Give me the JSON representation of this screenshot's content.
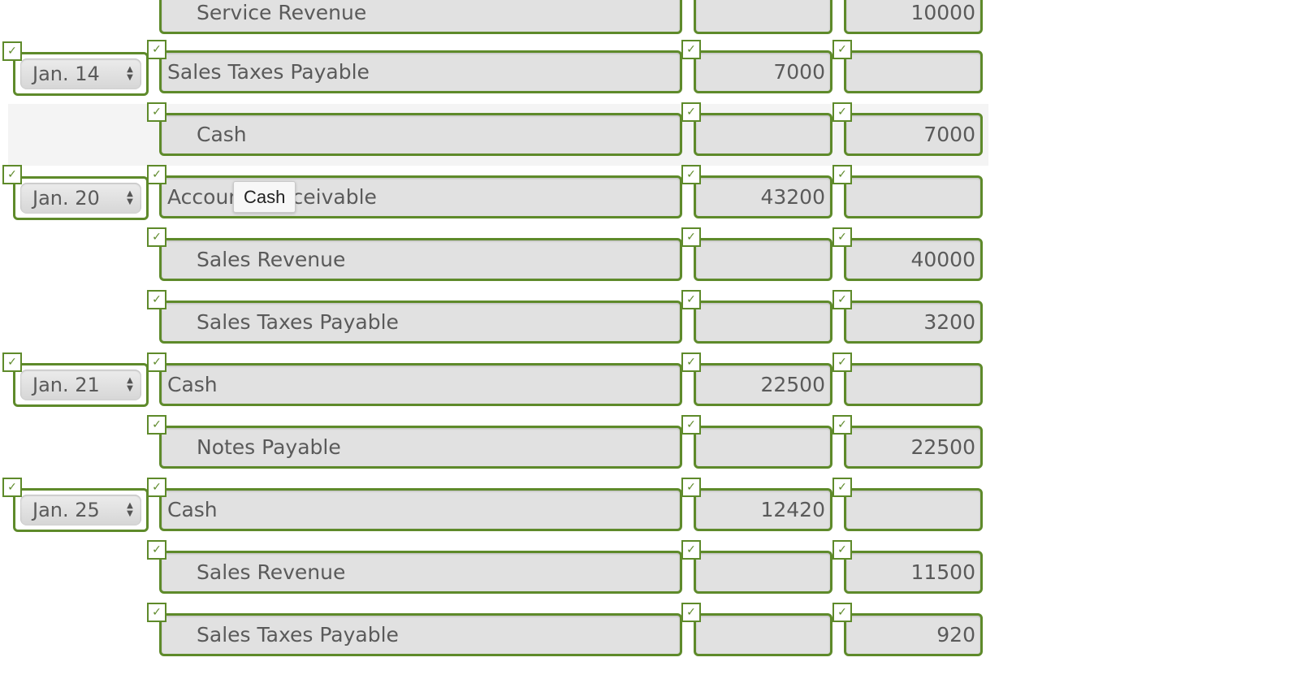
{
  "check_glyph": "✓",
  "entries": [
    {
      "date": "",
      "account": "Service Revenue",
      "indent": true,
      "debit": "",
      "credit": "10000"
    },
    {
      "date": "Jan. 14",
      "account": "Sales Taxes Payable",
      "indent": false,
      "debit": "7000",
      "credit": ""
    },
    {
      "date": "",
      "account": "Cash",
      "indent": true,
      "debit": "",
      "credit": "7000"
    },
    {
      "date": "Jan. 20",
      "account": "Accounts Receivable",
      "indent": false,
      "debit": "43200",
      "credit": ""
    },
    {
      "date": "",
      "account": "Sales Revenue",
      "indent": true,
      "debit": "",
      "credit": "40000"
    },
    {
      "date": "",
      "account": "Sales Taxes Payable",
      "indent": true,
      "debit": "",
      "credit": "3200"
    },
    {
      "date": "Jan. 21",
      "account": "Cash",
      "indent": false,
      "debit": "22500",
      "credit": ""
    },
    {
      "date": "",
      "account": "Notes Payable",
      "indent": true,
      "debit": "",
      "credit": "22500"
    },
    {
      "date": "Jan. 25",
      "account": "Cash",
      "indent": false,
      "debit": "12420",
      "credit": ""
    },
    {
      "date": "",
      "account": "Sales Revenue",
      "indent": true,
      "debit": "",
      "credit": "11500"
    },
    {
      "date": "",
      "account": "Sales Taxes Payable",
      "indent": true,
      "debit": "",
      "credit": "920"
    }
  ],
  "tooltip": {
    "text": "Cash"
  },
  "colors": {
    "accent": "#5e8a2a",
    "field_bg": "#e1e1e1",
    "text": "#5a5a5a"
  }
}
